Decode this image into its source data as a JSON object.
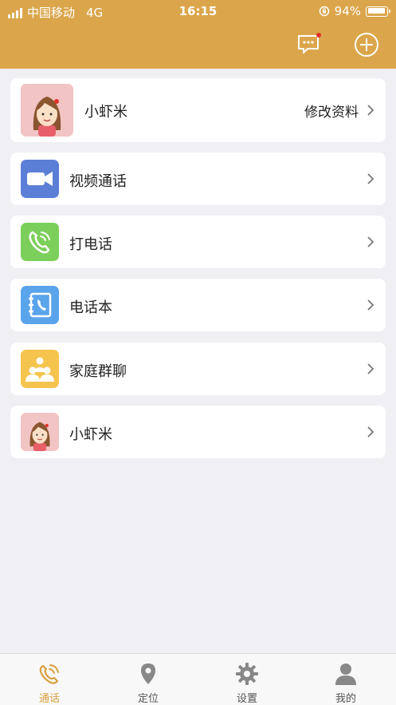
{
  "status_bar": {
    "carrier": "中国移动",
    "network": "4G",
    "time": "16:15",
    "battery": "94%"
  },
  "header": {
    "background_color": "#dba64b",
    "message_icon": "chat-bubble-icon",
    "add_icon": "plus-circle-icon"
  },
  "profile": {
    "name": "小虾米",
    "edit_label": "修改资料",
    "avatar_icon": "girl-avatar-icon"
  },
  "menu": [
    {
      "label": "视频通话",
      "icon": "video-camera-icon",
      "color": "#5b7fd6"
    },
    {
      "label": "打电话",
      "icon": "phone-icon",
      "color": "#7ccf5b"
    },
    {
      "label": "电话本",
      "icon": "phonebook-icon",
      "color": "#5aa4ec"
    },
    {
      "label": "家庭群聊",
      "icon": "group-icon",
      "color": "#f5c44e"
    },
    {
      "label": "小虾米",
      "icon": "girl-avatar-icon",
      "color": "#f2c4c4"
    }
  ],
  "tabbar": {
    "accent_color": "#d9a03f",
    "tabs": [
      {
        "label": "通话",
        "icon": "phone-tab-icon",
        "active": true
      },
      {
        "label": "定位",
        "icon": "location-pin-icon",
        "active": false
      },
      {
        "label": "设置",
        "icon": "gear-icon",
        "active": false
      },
      {
        "label": "我的",
        "icon": "person-icon",
        "active": false
      }
    ]
  }
}
